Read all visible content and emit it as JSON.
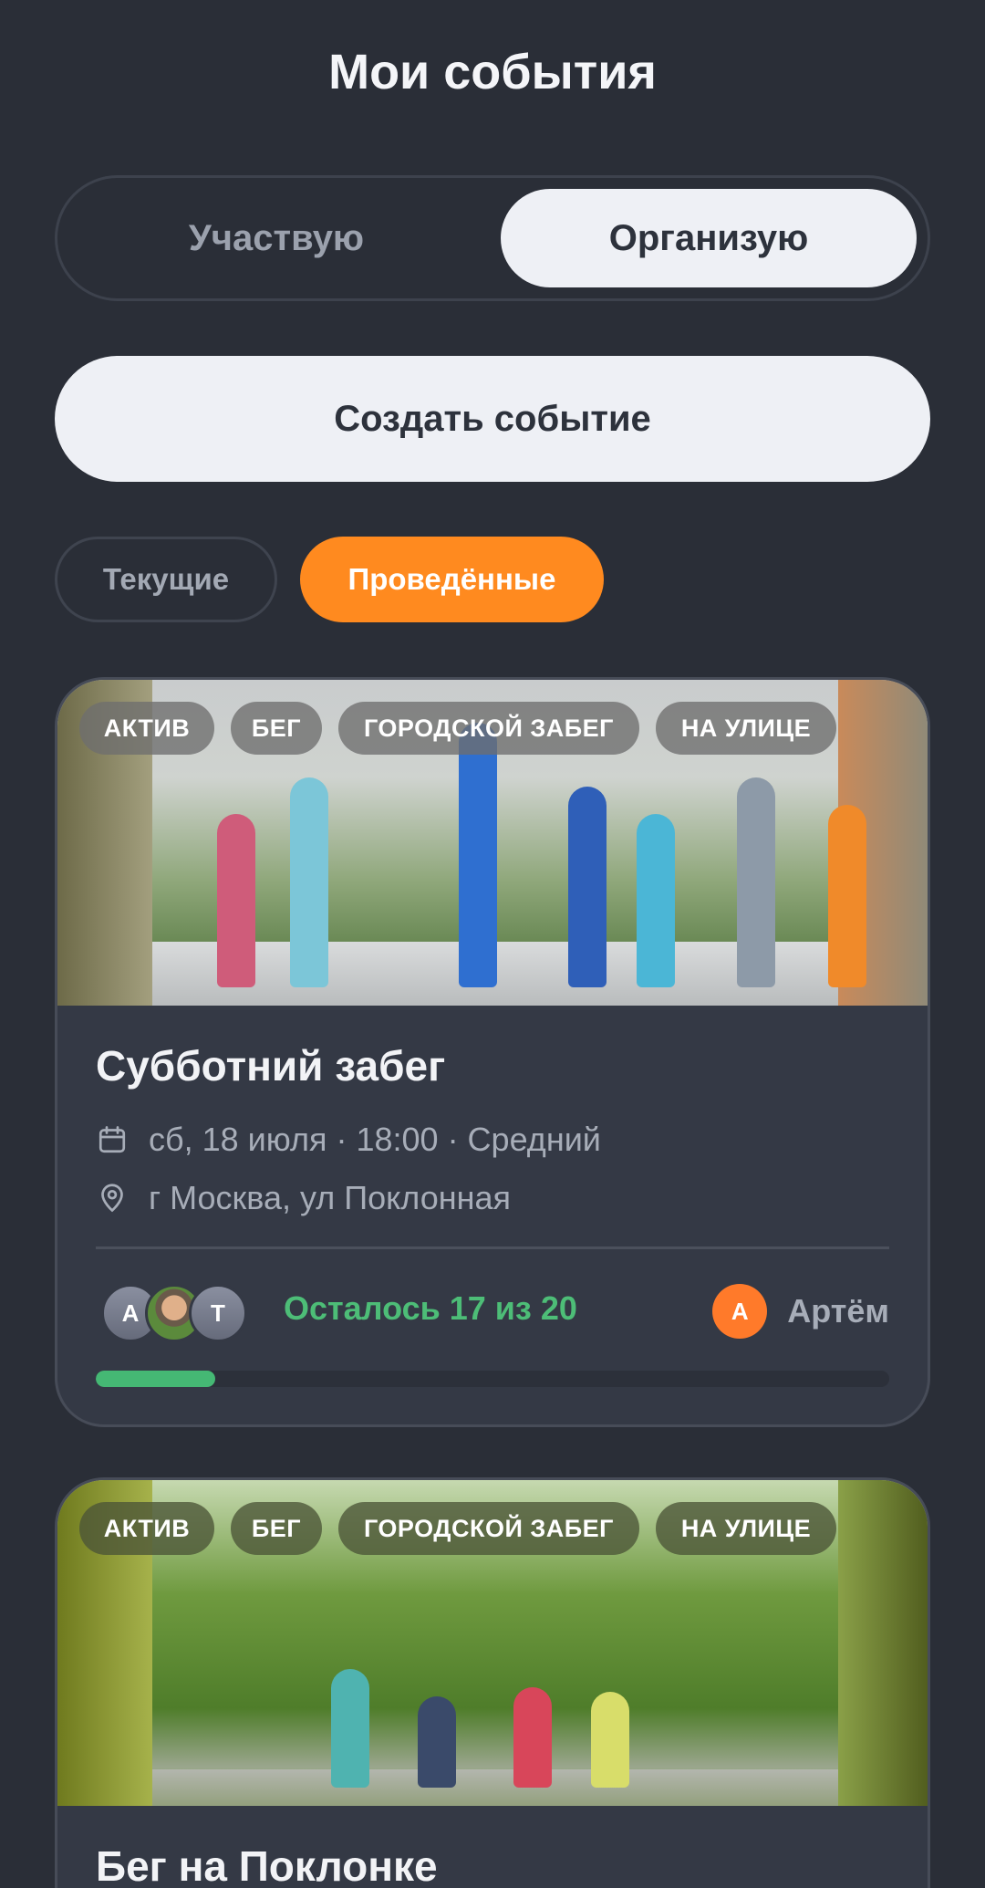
{
  "header": {
    "title": "Мои события"
  },
  "segment": {
    "participate": "Участвую",
    "organize": "Организую",
    "selected": "Организую"
  },
  "create_button": "Создать событие",
  "filters": {
    "current": "Текущие",
    "past": "Проведённые",
    "selected": "Проведённые"
  },
  "colors": {
    "accent": "#ff8a1f",
    "progress": "#45b874",
    "background": "#2a2e37",
    "card": "#343945"
  },
  "events": [
    {
      "tags": [
        "АКТИВ",
        "БЕГ",
        "ГОРОДСКОЙ ЗАБЕГ",
        "НА УЛИЦЕ"
      ],
      "title": "Субботний забег",
      "datetime": "сб, 18 июля · 18:00 · Средний",
      "location": "г Москва, ул Поклонная",
      "participants": [
        {
          "initial": "А",
          "photo": false
        },
        {
          "initial": "",
          "photo": true
        },
        {
          "initial": "Т",
          "photo": false
        }
      ],
      "remaining": "Осталось 17 из 20",
      "progress_fraction": 0.15,
      "organizer": {
        "initial": "А",
        "name": "Артём"
      },
      "icons": {
        "date": "calendar-icon",
        "location": "map-pin-icon"
      }
    },
    {
      "tags": [
        "АКТИВ",
        "БЕГ",
        "ГОРОДСКОЙ ЗАБЕГ",
        "НА УЛИЦЕ"
      ],
      "title": "Бег на Поклонке"
    }
  ]
}
